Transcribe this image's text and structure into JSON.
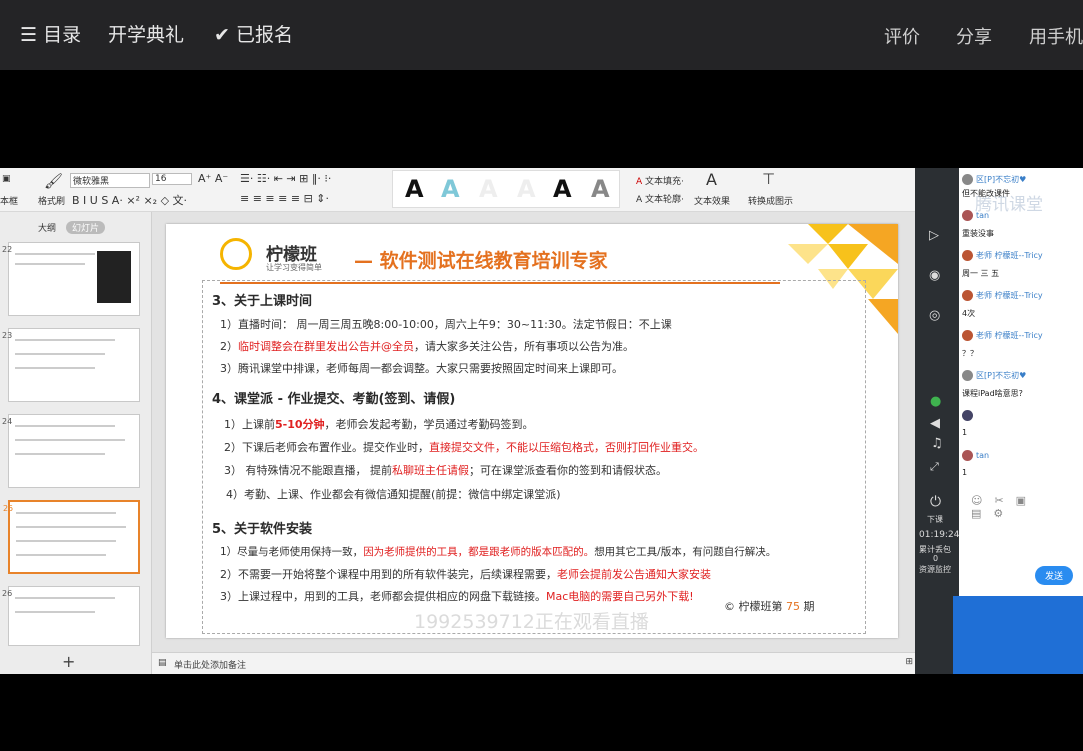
{
  "topbar": {
    "menu_label": "目录",
    "course_title": "开学典礼",
    "enrolled_label": "已报名",
    "rate_label": "评价",
    "share_label": "分享",
    "mobile_label": "用手机"
  },
  "ribbon": {
    "textbox_label": "本框",
    "format_painter": "格式刷",
    "font_name": "微软雅黑",
    "font_size": "16",
    "text_fill": "文本填充",
    "text_outline": "文本轮廓",
    "text_effect": "文本效果",
    "convert_label": "转换成图示"
  },
  "thumbs": {
    "tab_outline": "大纲",
    "tab_slides": "幻灯片",
    "nums": [
      "22",
      "23",
      "24",
      "25",
      "26"
    ],
    "add": "+"
  },
  "slide": {
    "brand": "柠檬班",
    "brand_sub": "让学习变得简单",
    "tagline": "— 软件测试在线教育培训专家",
    "s3_title": "3、关于上课时间",
    "s3_l1": "1）直播时间： 周一周三周五晚8:00-10:00，周六上午9：30~11:30。法定节假日：不上课",
    "s3_l2_num": "2）",
    "s3_l2_red": "临时调整会在群里发出公告并@全员",
    "s3_l2_rest": "，请大家多关注公告，所有事项以公告为准。",
    "s3_l3": "3）腾讯课堂中排课，老师每周一都会调整。大家只需要按照固定时间来上课即可。",
    "s4_title": "4、课堂派 - 作业提交、考勤(签到、请假)",
    "s4_l1_a": "1）上课前",
    "s4_l1_red": "5-10分钟",
    "s4_l1_b": "，老师会发起考勤，学员通过考勤码签到。",
    "s4_l2_a": "2）下课后老师会布置作业。提交作业时，",
    "s4_l2_red": "直接提交文件，不能以压缩包格式，否则打回作业重交。",
    "s4_l3_a": "3） 有特殊情况不能跟直播， 提前",
    "s4_l3_red": "私聊班主任请假",
    "s4_l3_b": "；可在课堂派查看你的签到和请假状态。",
    "s4_l4": "4）考勤、上课、作业都会有微信通知提醒(前提：微信中绑定课堂派)",
    "s5_title": "5、关于软件安装",
    "s5_l1_a": "1）尽量与老师使用保持一致，",
    "s5_l1_red": "因为老师提供的工具，都是跟老师的版本匹配的。",
    "s5_l1_b": "想用其它工具/版本，有问题自行解决。",
    "s5_l2_a": "2）不需要一开始将整个课程中用到的所有软件装完，后续课程需要，",
    "s5_l2_red": "老师会提前发公告通知大家安装",
    "s5_l3_a": "3）上课过程中，用到的工具，老师都会提供相应的网盘下载链接。",
    "s5_l3_red": "Mac电脑的需要自己另外下载!",
    "footer_a": "© 柠檬班第",
    "footer_num": "75",
    "footer_b": "期",
    "watermark": "1992539712正在观看直播"
  },
  "notes": {
    "placeholder": "单击此处添加备注"
  },
  "tool": {
    "down_label": "下课",
    "time": "01:19:24",
    "lost_label": "累计丢包",
    "lost_value": "0",
    "monitor": "资源监控"
  },
  "chat": {
    "logo": "腾讯课堂",
    "send": "发送",
    "msgs": [
      {
        "name": "区[P]不忘初♥",
        "text": "但不能改课件"
      },
      {
        "name": "tan",
        "text": "重装没事"
      },
      {
        "name": "老师 柠檬班--Tricy",
        "text": "周一 三 五"
      },
      {
        "name": "老师 柠檬班--Tricy",
        "text": "4次"
      },
      {
        "name": "老师 柠檬班--Tricy",
        "text": "？？"
      },
      {
        "name": "区[P]不忘初♥",
        "text": "课程iPad啥意思?"
      },
      {
        "name": "",
        "text": "1"
      },
      {
        "name": "tan",
        "text": "1"
      }
    ]
  }
}
